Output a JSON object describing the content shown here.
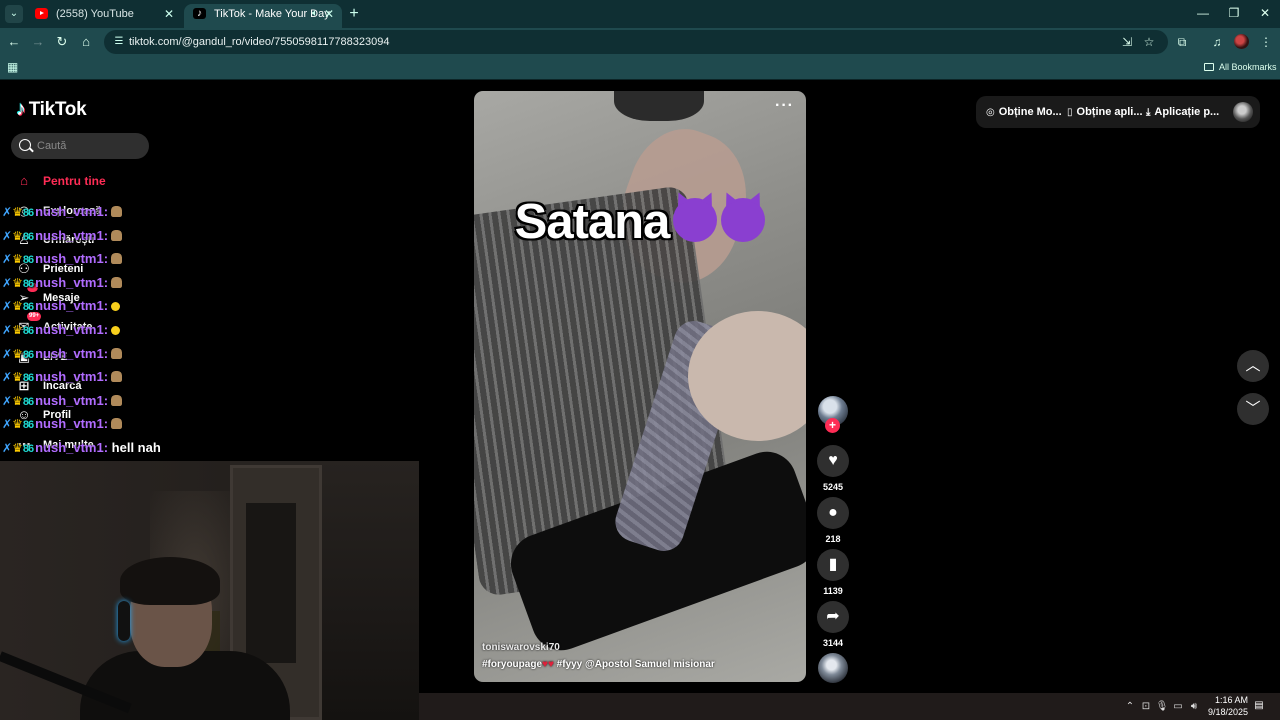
{
  "browser": {
    "tabs": [
      {
        "title": "(2558) YouTube",
        "favicon": "youtube-icon",
        "active": false
      },
      {
        "title": "TikTok - Make Your Day",
        "favicon": "tiktok-icon",
        "active": true
      }
    ],
    "url": "tiktok.com/@gandul_ro/video/7550598117788323094",
    "bookmarks_label": "All Bookmarks",
    "theme_color": "#1f4a4e"
  },
  "tiktok": {
    "logo": "TikTok",
    "search_placeholder": "Caută",
    "nav": [
      {
        "label": "Pentru tine",
        "icon": "home-icon",
        "active": true
      },
      {
        "label": "Explorează",
        "icon": "compass-icon"
      },
      {
        "label": "Urmărești",
        "icon": "following-icon"
      },
      {
        "label": "Prieteni",
        "icon": "friends-icon"
      },
      {
        "label": "Mesaje",
        "icon": "message-icon",
        "badge": "6"
      },
      {
        "label": "Activitate",
        "icon": "activity-icon",
        "badge": "99+"
      },
      {
        "label": "LIVE",
        "icon": "live-icon"
      },
      {
        "label": "Încarcă",
        "icon": "upload-icon"
      },
      {
        "label": "Profil",
        "icon": "profile-icon"
      },
      {
        "label": "Mai multe",
        "icon": "more-icon"
      }
    ],
    "top_actions": [
      {
        "label": "Obține Mo...",
        "icon": "coin-icon"
      },
      {
        "label": "Obține apli...",
        "icon": "phone-icon"
      },
      {
        "label": "Aplicație p...",
        "icon": "download-icon"
      }
    ],
    "video": {
      "caption_overlay": "Satana",
      "author": "toniswarovski70",
      "tags": [
        "#foryoupage",
        "#fyyy",
        "@Apostol Samuel misionar"
      ]
    },
    "actions": {
      "likes": "5245",
      "comments": "218",
      "saves": "1139",
      "shares": "3144"
    },
    "accent_color": "#fe2c55"
  },
  "chat": {
    "messages": [
      {
        "user": "nush_vtm1:",
        "text": "",
        "emote": "pray"
      },
      {
        "user": "nush_vtm1:",
        "text": "",
        "emote": "pray"
      },
      {
        "user": "nush_vtm1:",
        "text": "",
        "emote": "pray"
      },
      {
        "user": "nush_vtm1:",
        "text": "",
        "emote": "pray"
      },
      {
        "user": "nush_vtm1:",
        "text": "",
        "emote": "yellow"
      },
      {
        "user": "nush_vtm1:",
        "text": "",
        "emote": "yellow"
      },
      {
        "user": "nush_vtm1:",
        "text": "",
        "emote": "pray"
      },
      {
        "user": "nush_vtm1:",
        "text": "",
        "emote": "pray"
      },
      {
        "user": "nush_vtm1:",
        "text": "",
        "emote": "pray"
      },
      {
        "user": "nush_vtm1:",
        "text": "",
        "emote": "pray"
      },
      {
        "user": "nush_vtm1:",
        "text": "hell nah",
        "emote": ""
      }
    ]
  },
  "taskbar": {
    "time": "1:16 AM",
    "date": "9/18/2025"
  }
}
